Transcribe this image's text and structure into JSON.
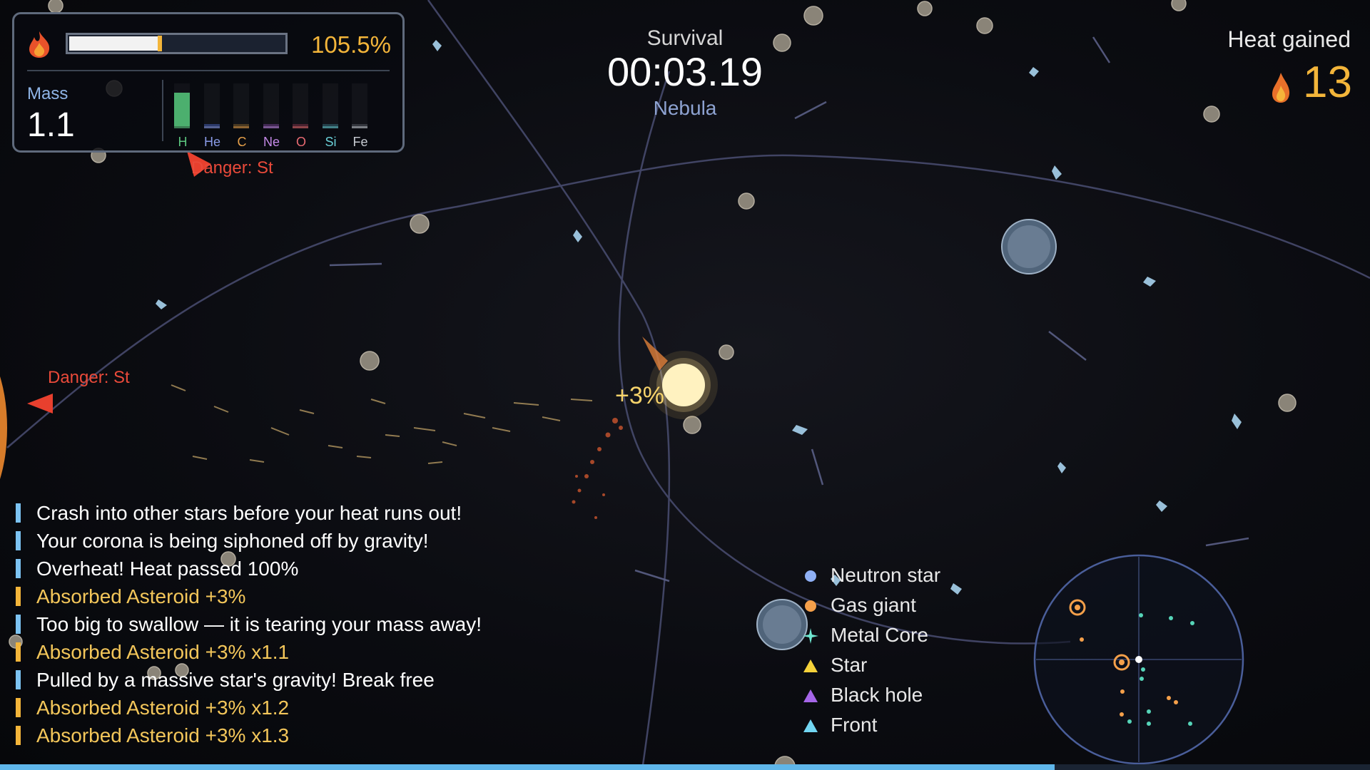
{
  "hud": {
    "heat_percent_text": "105.5%",
    "heat_fill_fraction": 0.43,
    "heat_tick_fraction": 0.42,
    "mass_label": "Mass",
    "mass_value": "1.1",
    "elements": [
      {
        "label": "H",
        "level": 0.78,
        "color": "#4caf6e",
        "label_color": "#5cc77f"
      },
      {
        "label": "He",
        "level": 0.05,
        "color": "#2c3a6a",
        "label_color": "#8a9ce8"
      },
      {
        "label": "C",
        "level": 0.05,
        "color": "#4a3a22",
        "label_color": "#e6a04a"
      },
      {
        "label": "Ne",
        "level": 0.05,
        "color": "#432a55",
        "label_color": "#c58ae8"
      },
      {
        "label": "O",
        "level": 0.05,
        "color": "#4a2230",
        "label_color": "#e86a72"
      },
      {
        "label": "Si",
        "level": 0.05,
        "color": "#24404a",
        "label_color": "#6ad0d8"
      },
      {
        "label": "Fe",
        "level": 0.05,
        "color": "#33363d",
        "label_color": "#c7cbd2"
      }
    ]
  },
  "warnings": {
    "top": "Danger: St",
    "left": "Danger: St"
  },
  "survival": {
    "label": "Survival",
    "timer": "00:03.19",
    "biome": "Nebula"
  },
  "heat_gained": {
    "label": "Heat gained",
    "value": "13"
  },
  "popup": "+3%",
  "log": [
    {
      "text": "Crash into other stars before your heat runs out!",
      "type": "info"
    },
    {
      "text": "Your corona is being siphoned off by gravity!",
      "type": "info"
    },
    {
      "text": "Overheat! Heat passed 100%",
      "type": "info"
    },
    {
      "text": "Absorbed Asteroid +3%",
      "type": "gain"
    },
    {
      "text": "Too big to swallow — it is tearing your mass away!",
      "type": "info"
    },
    {
      "text": "Absorbed Asteroid +3% x1.1",
      "type": "gain"
    },
    {
      "text": "Pulled by a massive star's gravity! Break free",
      "type": "info"
    },
    {
      "text": "Absorbed Asteroid +3% x1.2",
      "type": "gain"
    },
    {
      "text": "Absorbed Asteroid +3% x1.3",
      "type": "gain"
    }
  ],
  "log_colors": {
    "info": "#7cc3f2",
    "gain": "#f3b53a",
    "info_text": "#ffffff",
    "gain_text": "#f3c65a"
  },
  "legend": [
    {
      "label": "Neutron star",
      "shape": "circle",
      "color": "#8fb0f5"
    },
    {
      "label": "Gas giant",
      "shape": "circle",
      "color": "#f5a04a"
    },
    {
      "label": "Metal Core",
      "shape": "sparkle",
      "color": "#6fe6d0"
    },
    {
      "label": "Star",
      "shape": "triangle",
      "color": "#f5d23a"
    },
    {
      "label": "Black hole",
      "shape": "triangle",
      "color": "#a566e8"
    },
    {
      "label": "Front",
      "shape": "triangle",
      "color": "#72d6f2"
    }
  ],
  "progress_fraction": 0.77
}
